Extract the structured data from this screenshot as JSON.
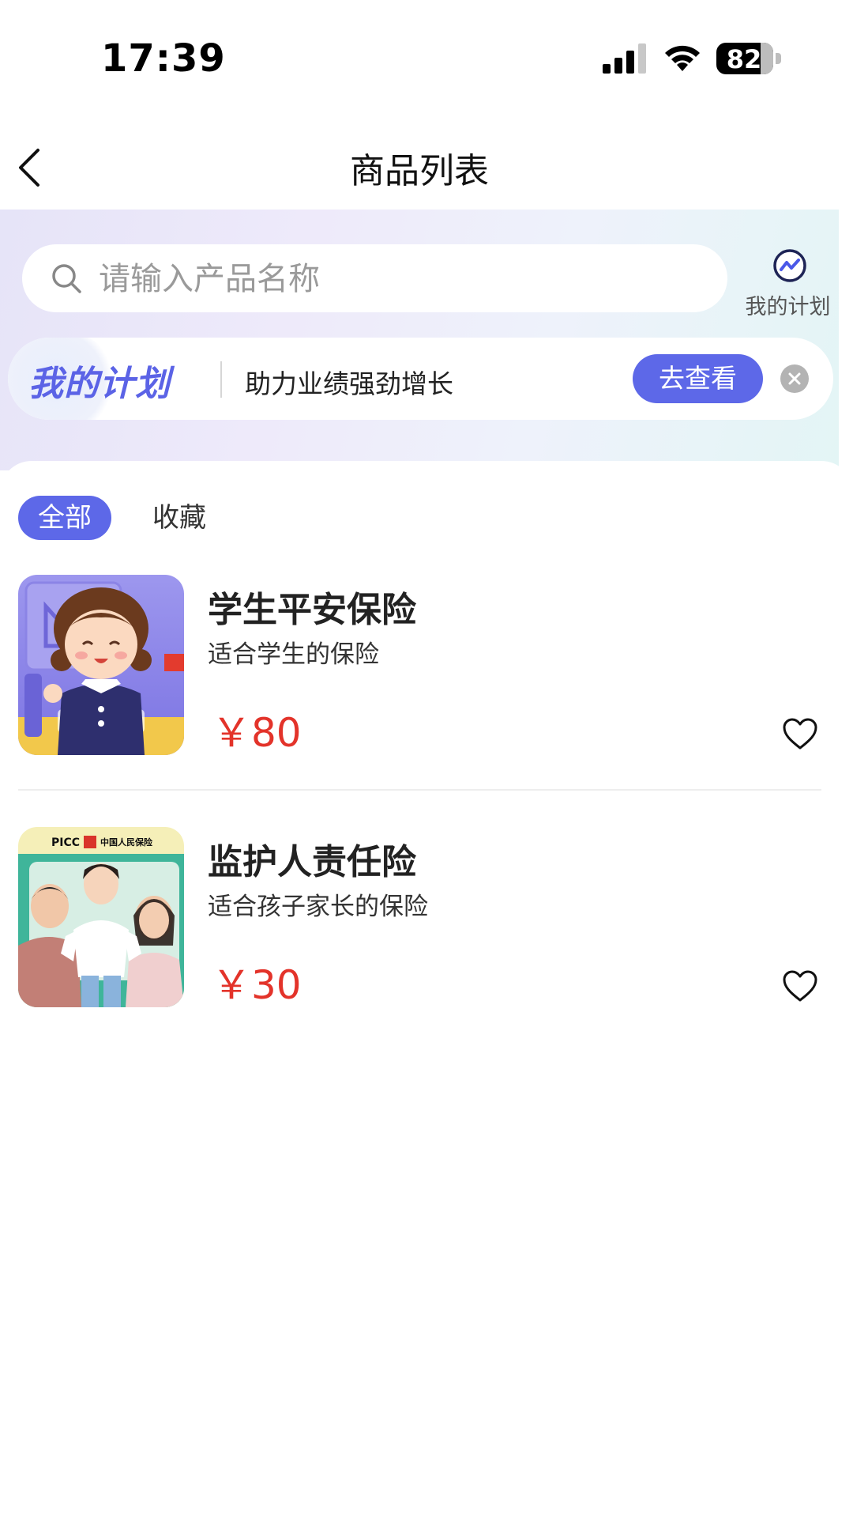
{
  "status_bar": {
    "time": "17:39",
    "battery": "82"
  },
  "nav": {
    "title": "商品列表"
  },
  "search": {
    "placeholder": "请输入产品名称"
  },
  "my_plan_shortcut": {
    "label": "我的计划"
  },
  "plan_banner": {
    "logo": "我的计划",
    "text": "助力业绩强劲增长",
    "button": "去查看"
  },
  "tabs": [
    {
      "label": "全部",
      "active": true
    },
    {
      "label": "收藏",
      "active": false
    }
  ],
  "products": [
    {
      "title": "学生平安保险",
      "desc": "适合学生的保险",
      "price": "￥80",
      "favorited": false
    },
    {
      "title": "监护人责任险",
      "desc": "适合孩子家长的保险",
      "price": "￥30",
      "favorited": false,
      "thumb_brand": "PICC",
      "thumb_brand_cn": "中国人民保险"
    }
  ],
  "colors": {
    "accent": "#5d68e8",
    "price": "#e3332a"
  }
}
